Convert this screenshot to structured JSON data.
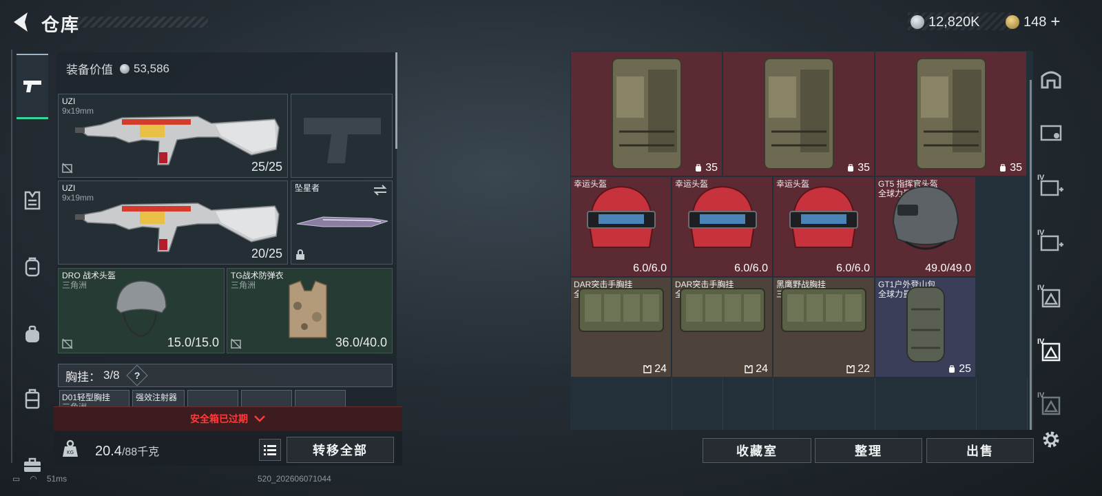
{
  "header": {
    "title": "仓库",
    "currency_silver": "12,820K",
    "currency_gold": "148"
  },
  "loadout": {
    "value_label": "装备价值",
    "value": "53,586",
    "slots": [
      {
        "name": "UZI",
        "sub": "9x19mm",
        "value": "25/25"
      },
      {
        "name": "UZI",
        "sub": "9x19mm",
        "value": "20/25"
      },
      {
        "name": "坠星者"
      },
      {
        "name": "DRO 战术头盔",
        "sub": "三角洲",
        "value": "15.0/15.0"
      },
      {
        "name": "TG战术防弹衣",
        "sub": "三角洲",
        "value": "36.0/40.0"
      }
    ],
    "chest_rig_label": "胸挂：",
    "chest_rig_count": "3/8",
    "help_mark": "?",
    "small_items": [
      {
        "name": "D01轻型胸挂",
        "sub": "三角洲"
      },
      {
        "name": "强效注射器"
      }
    ],
    "alert": "安全箱已过期",
    "weight": "20.4",
    "weight_cap": "/88千克",
    "transfer_all": "转移全部"
  },
  "stash": {
    "items": [
      {
        "name": "",
        "sub": "",
        "value": "35",
        "color": "red",
        "icon": "backpack-icon",
        "kind": "pack"
      },
      {
        "name": "",
        "sub": "",
        "value": "35",
        "color": "red",
        "icon": "backpack-icon",
        "kind": "pack"
      },
      {
        "name": "",
        "sub": "",
        "value": "35",
        "color": "red",
        "icon": "backpack-icon",
        "kind": "pack"
      },
      {
        "name": "幸运头盔",
        "sub": "",
        "value": "6.0/6.0",
        "color": "red",
        "kind": "helmet-red"
      },
      {
        "name": "幸运头盔",
        "sub": "",
        "value": "6.0/6.0",
        "color": "red",
        "kind": "helmet-red"
      },
      {
        "name": "幸运头盔",
        "sub": "",
        "value": "6.0/6.0",
        "color": "red",
        "kind": "helmet-red"
      },
      {
        "name": "GT5 指挥官头盔",
        "sub": "全球力量",
        "value": "49.0/49.0",
        "color": "red",
        "kind": "helmet-gray"
      },
      {
        "name": "DAR突击手胸挂",
        "sub": "全球力量",
        "value": "24",
        "color": "tan",
        "icon": "vest-icon",
        "kind": "rig"
      },
      {
        "name": "DAR突击手胸挂",
        "sub": "全球力量",
        "value": "24",
        "color": "tan",
        "icon": "vest-icon",
        "kind": "rig"
      },
      {
        "name": "黑鹰野战胸挂",
        "sub": "三角洲",
        "value": "22",
        "color": "tan",
        "icon": "vest-icon",
        "kind": "rig"
      },
      {
        "name": "GT1户外登山包",
        "sub": "全球力量",
        "value": "25",
        "color": "blue",
        "icon": "backpack-icon",
        "kind": "bag"
      }
    ],
    "buttons": {
      "collection": "收藏室",
      "sort": "整理",
      "sell": "出售"
    }
  },
  "right_rail": {
    "tier_labels": [
      "IV",
      "IV",
      "IV",
      "IV",
      "IV"
    ]
  },
  "footer": {
    "ping": "51ms",
    "build": "520_202606071044"
  },
  "colors": {
    "accent_green": "#2fd89a",
    "alert_red": "#ff3b3b",
    "stash_red": "#5b2a33",
    "stash_tan": "#4e433a",
    "stash_blue": "#3a3e58"
  }
}
